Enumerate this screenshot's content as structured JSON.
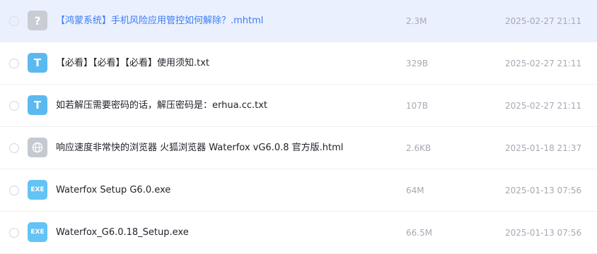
{
  "files": [
    {
      "name": "【鸿蒙系统】手机风险应用管控如何解除？.mhtml",
      "size": "2.3M",
      "date": "2025-02-27 21:11",
      "icon": "unknown-file-icon",
      "icon_glyph": "?",
      "selected": true
    },
    {
      "name": "【必看】【必看】【必看】使用须知.txt",
      "size": "329B",
      "date": "2025-02-27 21:11",
      "icon": "text-file-icon",
      "icon_glyph": "T",
      "selected": false
    },
    {
      "name": "如若解压需要密码的话，解压密码是：erhua.cc.txt",
      "size": "107B",
      "date": "2025-02-27 21:11",
      "icon": "text-file-icon",
      "icon_glyph": "T",
      "selected": false
    },
    {
      "name": "响应速度非常快的浏览器 火狐浏览器 Waterfox vG6.0.8 官方版.html",
      "size": "2.6KB",
      "date": "2025-01-18 21:37",
      "icon": "globe-icon",
      "icon_glyph": "",
      "selected": false
    },
    {
      "name": "Waterfox Setup G6.0.exe",
      "size": "64M",
      "date": "2025-01-13 07:56",
      "icon": "exe-file-icon",
      "icon_glyph": "EXE",
      "selected": false
    },
    {
      "name": "Waterfox_G6.0.18_Setup.exe",
      "size": "66.5M",
      "date": "2025-01-13 07:56",
      "icon": "exe-file-icon",
      "icon_glyph": "EXE",
      "selected": false
    }
  ],
  "colors": {
    "selected_row_bg": "#eaf0fd",
    "selected_text": "#3d7cf5",
    "txt_icon": "#5bb9f0",
    "exe_icon": "#63c3f5",
    "grey_icon": "#c8ccd3"
  }
}
